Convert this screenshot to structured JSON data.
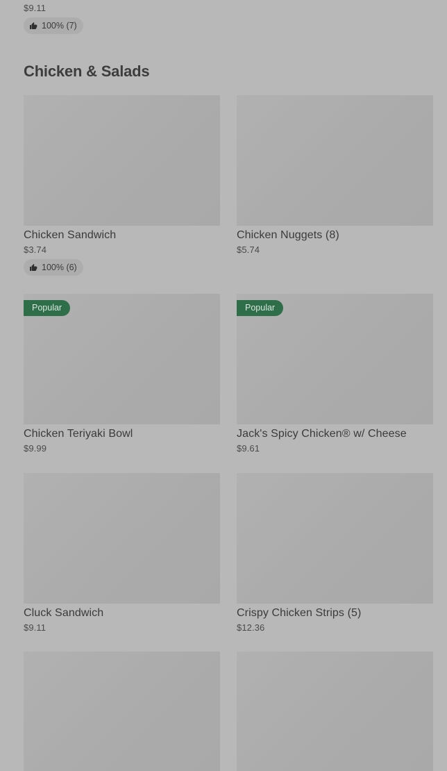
{
  "top_item": {
    "price": "$9.11",
    "rating": "100% (7)"
  },
  "section": {
    "title": "Chicken & Salads"
  },
  "items": [
    {
      "name": "Chicken Sandwich",
      "price": "$3.74",
      "rating": "100% (6)"
    },
    {
      "name": "Chicken Nuggets (8)",
      "price": "$5.74"
    },
    {
      "name": "Chicken Teriyaki Bowl",
      "price": "$9.99",
      "badge": "Popular"
    },
    {
      "name": "Jack's Spicy Chicken® w/ Cheese",
      "price": "$9.61",
      "badge": "Popular"
    },
    {
      "name": "Cluck Sandwich",
      "price": "$9.11"
    },
    {
      "name": "Crispy Chicken Strips (5)",
      "price": "$12.36"
    }
  ],
  "icons": {
    "rating": "thumbs-up-icon"
  }
}
